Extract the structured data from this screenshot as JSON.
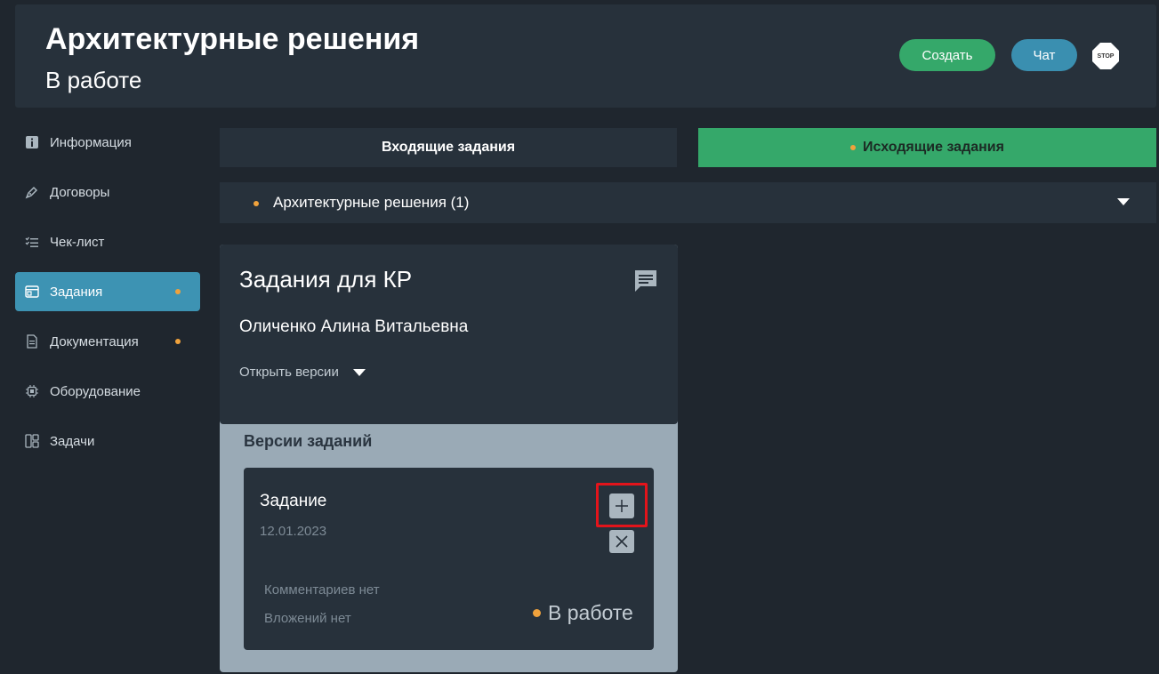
{
  "header": {
    "title": "Архитектурные решения",
    "subtitle": "В работе",
    "create_label": "Создать",
    "chat_label": "Чат",
    "stop_label": "STOP"
  },
  "sidebar": {
    "items": [
      {
        "label": "Информация",
        "icon": "info-icon",
        "dot": false
      },
      {
        "label": "Договоры",
        "icon": "pen-icon",
        "dot": false
      },
      {
        "label": "Чек-лист",
        "icon": "checklist-icon",
        "dot": false
      },
      {
        "label": "Задания",
        "icon": "window-icon",
        "dot": true,
        "active": true
      },
      {
        "label": "Документация",
        "icon": "document-icon",
        "dot": true
      },
      {
        "label": "Оборудование",
        "icon": "chip-icon",
        "dot": false
      },
      {
        "label": "Задачи",
        "icon": "board-icon",
        "dot": false
      }
    ]
  },
  "tabs": {
    "incoming": "Входящие задания",
    "outgoing": "Исходящие задания"
  },
  "section": {
    "label": "Архитектурные решения (1)"
  },
  "card": {
    "title": "Задания для КР",
    "person": "Оличенко Алина Витальевна",
    "open_versions": "Открыть версии",
    "versions_title": "Версии заданий",
    "version": {
      "title": "Задание",
      "date": "12.01.2023",
      "comments": "Комментариев нет",
      "attachments": "Вложений нет",
      "status": "В работе"
    }
  },
  "colors": {
    "background": "#1f262e",
    "panel": "#27313b",
    "green": "#35a86a",
    "blue": "#3a8fb0",
    "active_nav": "#3d93b3",
    "dot": "#f0a23c",
    "highlight": "#e3141b"
  }
}
